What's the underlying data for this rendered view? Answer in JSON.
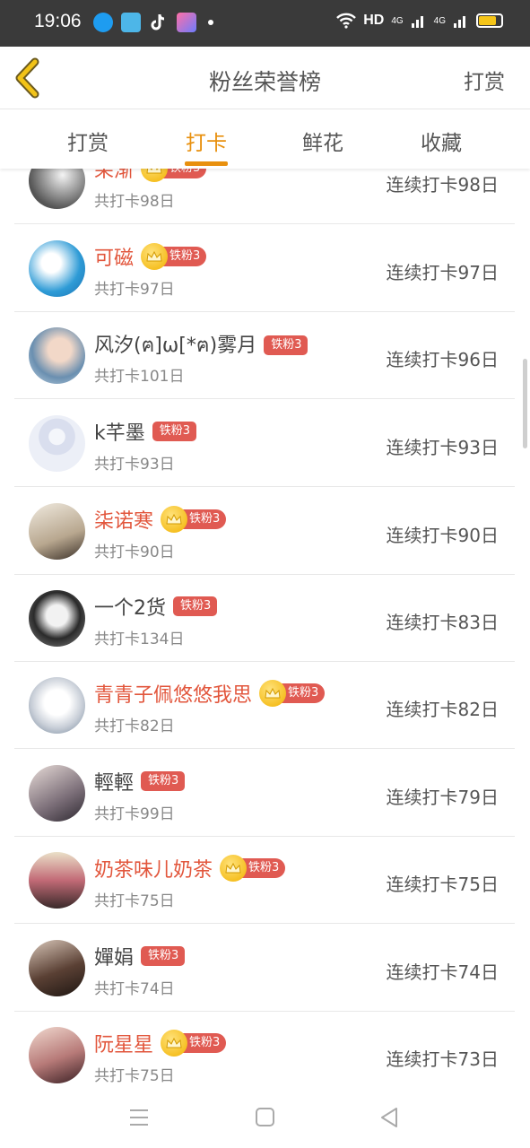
{
  "status_bar": {
    "time": "19:06",
    "network": "HD",
    "signal1": "4G",
    "signal2": "4G",
    "battery_level": 0.8,
    "apps": [
      "qq-icon",
      "gallery-icon",
      "tiktok-icon",
      "app-icon"
    ],
    "colors": {
      "background": "#3a3a3a",
      "battery": "#f5c518"
    }
  },
  "header": {
    "back_icon": "chevron-left-icon",
    "title": "粉丝荣誉榜",
    "action": "打赏"
  },
  "tabs": [
    {
      "label": "打赏",
      "active": false
    },
    {
      "label": "打卡",
      "active": true
    },
    {
      "label": "鲜花",
      "active": false
    },
    {
      "label": "收藏",
      "active": false
    }
  ],
  "badge_label": "铁粉3",
  "rows": [
    {
      "name": "呆渐",
      "vip": true,
      "total": "共打卡98日",
      "streak": "连续打卡98日"
    },
    {
      "name": "可磁",
      "vip": true,
      "total": "共打卡97日",
      "streak": "连续打卡97日"
    },
    {
      "name": "风汐(ฅ]ω[*ฅ)雾月",
      "vip": false,
      "total": "共打卡101日",
      "streak": "连续打卡96日"
    },
    {
      "name": "k芊墨",
      "vip": false,
      "total": "共打卡93日",
      "streak": "连续打卡93日"
    },
    {
      "name": "柒诺寒",
      "vip": true,
      "total": "共打卡90日",
      "streak": "连续打卡90日"
    },
    {
      "name": "一个2货",
      "vip": false,
      "total": "共打卡134日",
      "streak": "连续打卡83日"
    },
    {
      "name": "青青子佩悠悠我思",
      "vip": true,
      "total": "共打卡82日",
      "streak": "连续打卡82日"
    },
    {
      "name": "輕輕",
      "vip": false,
      "total": "共打卡99日",
      "streak": "连续打卡79日"
    },
    {
      "name": "奶茶味儿奶茶",
      "vip": true,
      "total": "共打卡75日",
      "streak": "连续打卡75日"
    },
    {
      "name": "嬋娟",
      "vip": false,
      "total": "共打卡74日",
      "streak": "连续打卡74日"
    },
    {
      "name": "阮星星",
      "vip": true,
      "total": "共打卡75日",
      "streak": "连续打卡73日"
    }
  ],
  "colors": {
    "accent": "#e8900e",
    "vip_name": "#e2563c",
    "badge": "#e05a52",
    "crown": "#f2b200"
  },
  "nav_bar": {
    "buttons": [
      "menu-icon",
      "home-square-icon",
      "back-triangle-icon"
    ]
  }
}
